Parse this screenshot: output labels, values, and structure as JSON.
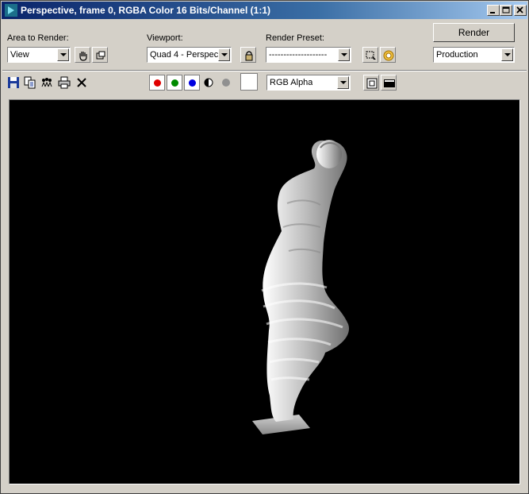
{
  "window": {
    "title": "Perspective, frame 0, RGBA Color 16 Bits/Channel (1:1)",
    "icon": "3ds-max-app-icon"
  },
  "controls": {
    "area_label": "Area to Render:",
    "area_value": "View",
    "viewport_label": "Viewport:",
    "viewport_value": "Quad 4 - Perspect",
    "preset_label": "Render Preset:",
    "preset_value": "--------------------",
    "render_button": "Render",
    "render_mode": "Production"
  },
  "toolbar": {
    "channel_value": "RGB Alpha",
    "colors": {
      "red": "#e00000",
      "green": "#008a00",
      "blue": "#0000e0",
      "gray": "#909090"
    }
  },
  "icons": [
    "save-icon",
    "copy-icon",
    "clone-icon",
    "print-icon",
    "clear-icon",
    "auto-region-icon",
    "lock-icon",
    "region-select-icon",
    "render-setup-icon",
    "display-toggle-icon",
    "channel-display-icon"
  ]
}
